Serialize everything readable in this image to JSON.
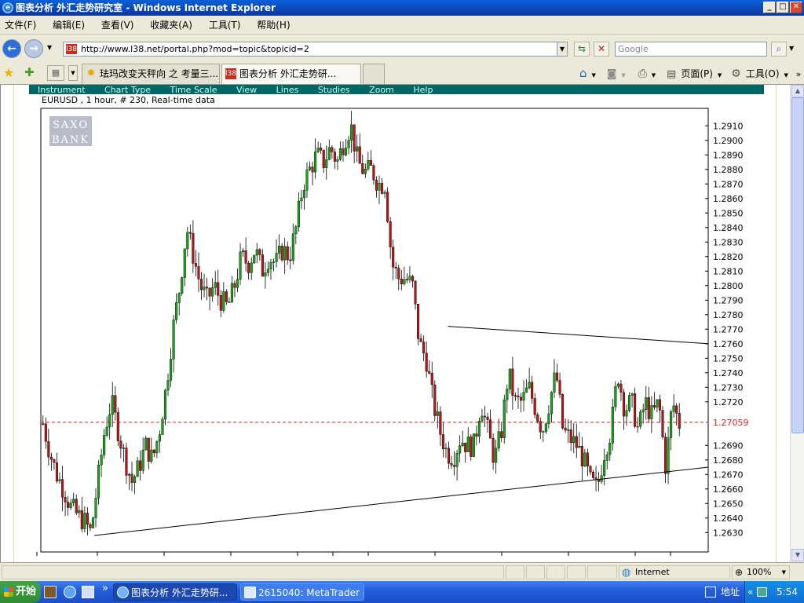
{
  "window": {
    "title": "图表分析 外汇走势研究室 - Windows Internet Explorer"
  },
  "menubar": {
    "items": [
      "文件(F)",
      "编辑(E)",
      "查看(V)",
      "收藏夹(A)",
      "工具(T)",
      "帮助(H)"
    ]
  },
  "address": {
    "url": "http://www.l38.net/portal.php?mod=topic&topicid=2",
    "favicon": "l38",
    "search_placeholder": "Google"
  },
  "tabs": [
    {
      "label": "珐玛改变天秤向 之 考量三...",
      "icon": "sun-icon"
    },
    {
      "label": "图表分析 外汇走势研...",
      "icon": "l38-icon",
      "active": true
    }
  ],
  "commandbar": {
    "page": "页面(P)",
    "tools": "工具(O)"
  },
  "chart_menu": [
    "Instrument",
    "Chart Type",
    "Time Scale",
    "View",
    "Lines",
    "Studies",
    "Zoom",
    "Help"
  ],
  "chart_title": "EURUSD , 1 hour, # 230, Real-time data",
  "logo": {
    "line1": "SAXO",
    "line2": "BANK"
  },
  "chart_data": {
    "type": "candlestick",
    "instrument": "EURUSD",
    "timeframe": "1 hour",
    "bars": 230,
    "y_ticks": [
      "1.2910",
      "1.2900",
      "1.2890",
      "1.2880",
      "1.2870",
      "1.2860",
      "1.2850",
      "1.2840",
      "1.2830",
      "1.2820",
      "1.2810",
      "1.2800",
      "1.2790",
      "1.2780",
      "1.2770",
      "1.2760",
      "1.2750",
      "1.2740",
      "1.2730",
      "1.2720",
      "1.2690",
      "1.2680",
      "1.2670",
      "1.2660",
      "1.2650",
      "1.2640",
      "1.2630"
    ],
    "ylim": [
      1.2625,
      1.2918
    ],
    "current_price": "1.27059",
    "price_path": [
      1.2705,
      1.2685,
      1.267,
      1.266,
      1.2648,
      1.2642,
      1.2638,
      1.263,
      1.2665,
      1.27,
      1.272,
      1.27,
      1.268,
      1.2665,
      1.2675,
      1.269,
      1.268,
      1.27,
      1.273,
      1.277,
      1.28,
      1.284,
      1.282,
      1.28,
      1.279,
      1.28,
      1.279,
      1.2785,
      1.28,
      1.282,
      1.2815,
      1.2825,
      1.281,
      1.282,
      1.2815,
      1.2825,
      1.282,
      1.284,
      1.287,
      1.288,
      1.289,
      1.2885,
      1.2895,
      1.2885,
      1.29,
      1.291,
      1.2885,
      1.2878,
      1.288,
      1.287,
      1.287,
      1.2815,
      1.2805,
      1.2805,
      1.28,
      1.276,
      1.275,
      1.272,
      1.27,
      1.2685,
      1.2682,
      1.2695,
      1.269,
      1.269,
      1.272,
      1.27,
      1.268,
      1.27,
      1.274,
      1.272,
      1.272,
      1.273,
      1.2715,
      1.27,
      1.272,
      1.274,
      1.27,
      1.2695,
      1.269,
      1.268,
      1.2665,
      1.266,
      1.2685,
      1.27,
      1.274,
      1.2715,
      1.272,
      1.27,
      1.272,
      1.271,
      1.272,
      1.2675,
      1.272,
      1.2705
    ],
    "trendlines": [
      {
        "from": [
          1.2628,
          0.08
        ],
        "to": [
          1.2675,
          1.0
        ]
      },
      {
        "from": [
          1.2772,
          0.61
        ],
        "to": [
          1.276,
          1.0
        ]
      }
    ],
    "colors": {
      "up": "#19a319",
      "down": "#b51818",
      "current_line": "#cc2222"
    }
  },
  "statusbar": {
    "zone": "Internet",
    "zoom": "100%"
  },
  "taskbar": {
    "start": "开始",
    "tasks": [
      "图表分析 外汇走势研...",
      "2615040: MetaTrader - ..."
    ],
    "address_label": "地址",
    "time": "5:54"
  }
}
